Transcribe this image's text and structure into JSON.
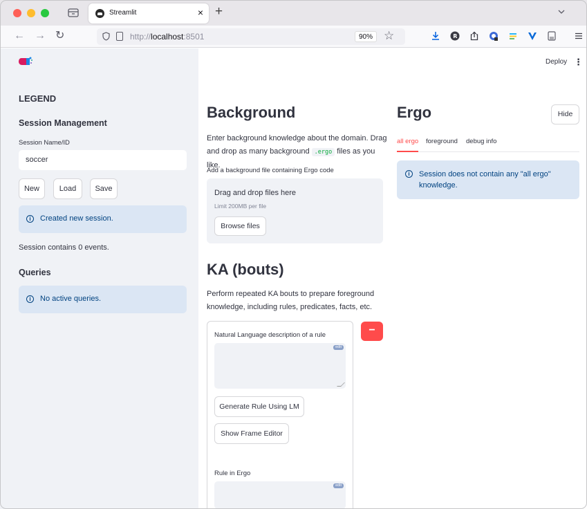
{
  "browser": {
    "tab_title": "Streamlit",
    "tab_close": "×",
    "new_tab": "+",
    "url_host": "http://",
    "url_bold": "localhost",
    "url_port": ":8501",
    "zoom": "90%"
  },
  "header": {
    "deploy": "Deploy",
    "menu": "⋮"
  },
  "sidebar": {
    "legend": "LEGEND",
    "session_heading": "Session Management",
    "session_label": "Session Name/ID",
    "session_value": "soccer",
    "buttons": {
      "new": "New",
      "load": "Load",
      "save": "Save"
    },
    "alert_created": "Created new session.",
    "events": "Session contains 0 events.",
    "queries_heading": "Queries",
    "alert_queries": "No active queries."
  },
  "background": {
    "title": "Background",
    "desc_before": "Enter background knowledge about the domain. Drag and drop as many background ",
    "desc_code": ".ergo",
    "desc_after": " files as you like.",
    "file_label": "Add a background file containing Ergo code",
    "drop_title": "Drag and drop files here",
    "drop_limit": "Limit 200MB per file",
    "browse": "Browse files"
  },
  "ka": {
    "title": "KA (bouts)",
    "desc": "Perform repeated KA bouts to prepare foreground knowledge, including rules, predicates, facts, etc.",
    "nl_label": "Natural Language description of a rule",
    "edit_tag": "edit",
    "generate": "Generate Rule Using LM",
    "frame_editor": "Show Frame Editor",
    "rule_label": "Rule in Ergo",
    "remove": "−"
  },
  "ergo": {
    "title": "Ergo",
    "hide": "Hide",
    "tabs": [
      "all ergo",
      "foreground",
      "debug info"
    ],
    "alert": "Session does not contain any \"all ergo\" knowledge."
  },
  "colors": {
    "accent": "#ff4b4b",
    "sidebar_bg": "#f0f2f6",
    "info_bg": "#dbe6f4",
    "info_text": "#004280"
  }
}
